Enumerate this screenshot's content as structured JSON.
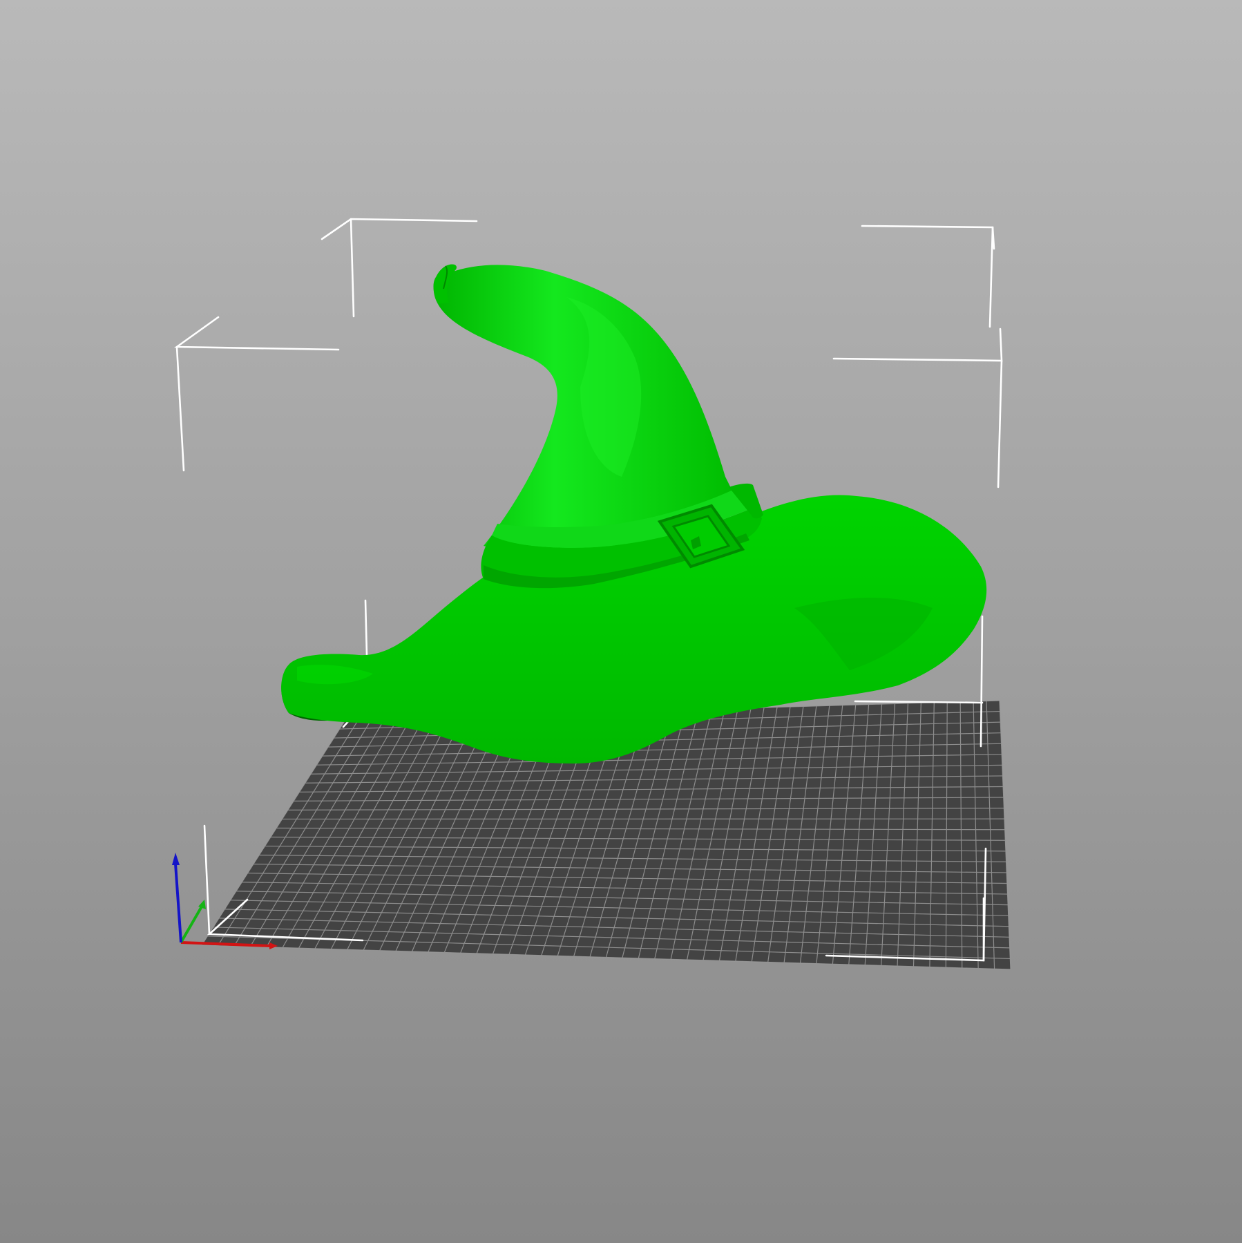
{
  "viewport": {
    "name": "3d-print-preview",
    "background_top": "#b9b9b9",
    "background_bottom": "#878787"
  },
  "bed": {
    "plate_color": "#434343",
    "grid_color": "#9a9a9a"
  },
  "bounding_box": {
    "color": "#ffffff"
  },
  "model": {
    "object": "witch-hat",
    "color": "#00c800",
    "highlight": "#14e61e",
    "shadow": "#006e00"
  },
  "axes": {
    "x_color": "#d21414",
    "y_color": "#14b414",
    "z_color": "#1414c8"
  }
}
